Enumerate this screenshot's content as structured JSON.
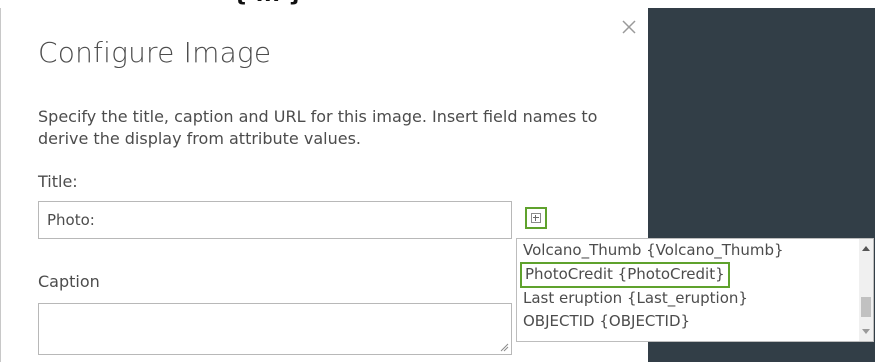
{
  "background_partial_text": "{ ... }",
  "dialog": {
    "title": "Configure Image",
    "description": "Specify the title, caption and URL for this image. Insert field names to derive the display from attribute values.",
    "title_label": "Title:",
    "title_value": "Photo:",
    "caption_label": "Caption",
    "caption_value": ""
  },
  "field_list": {
    "items": [
      {
        "label": "Volcano_Thumb {Volcano_Thumb}"
      },
      {
        "label": "PhotoCredit {PhotoCredit}"
      },
      {
        "label": "Last eruption {Last_eruption}"
      },
      {
        "label": "OBJECTID {OBJECTID}"
      }
    ],
    "highlighted_index": 1
  },
  "colors": {
    "highlight_border": "#5fa22d",
    "side_panel": "#323e47",
    "text": "#4c4c4c"
  }
}
